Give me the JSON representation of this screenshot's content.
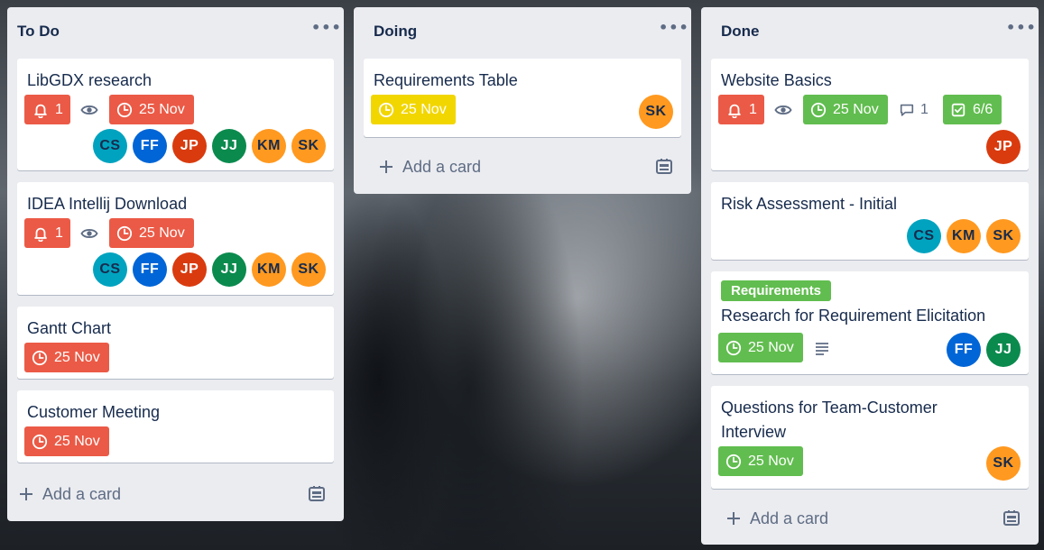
{
  "colors": {
    "red": "#eb5a46",
    "green": "#61bd4f",
    "yellow": "#f2d600",
    "list_bg": "#ebecf0"
  },
  "lists": [
    {
      "title": "To Do",
      "menu": "•••",
      "add_card": "Add a card",
      "cards": [
        {
          "title": "LibGDX research",
          "notifications": "1",
          "date": "25 Nov",
          "members": [
            "CS",
            "FF",
            "JP",
            "JJ",
            "KM",
            "SK"
          ]
        },
        {
          "title": "IDEA Intellij Download",
          "notifications": "1",
          "date": "25 Nov",
          "members": [
            "CS",
            "FF",
            "JP",
            "JJ",
            "KM",
            "SK"
          ]
        },
        {
          "title": "Gantt Chart",
          "date": "25 Nov"
        },
        {
          "title": "Customer Meeting",
          "date": "25 Nov"
        }
      ]
    },
    {
      "title": "Doing",
      "menu": "•••",
      "add_card": "Add a card",
      "cards": [
        {
          "title": "Requirements Table",
          "date": "25 Nov",
          "members": [
            "SK"
          ]
        }
      ]
    },
    {
      "title": "Done",
      "menu": "•••",
      "add_card": "Add a card",
      "cards": [
        {
          "title": "Website Basics",
          "notifications": "1",
          "date": "25 Nov",
          "comments": "1",
          "checklist": "6/6",
          "members": [
            "JP"
          ]
        },
        {
          "title": "Risk Assessment - Initial",
          "members": [
            "CS",
            "KM",
            "SK"
          ]
        },
        {
          "label": "Requirements",
          "title": "Research for Requirement Elicitation",
          "date": "25 Nov",
          "members": [
            "FF",
            "JJ"
          ]
        },
        {
          "title": "Questions for Team-Customer Interview",
          "date": "25 Nov",
          "members": [
            "SK"
          ]
        }
      ]
    }
  ]
}
